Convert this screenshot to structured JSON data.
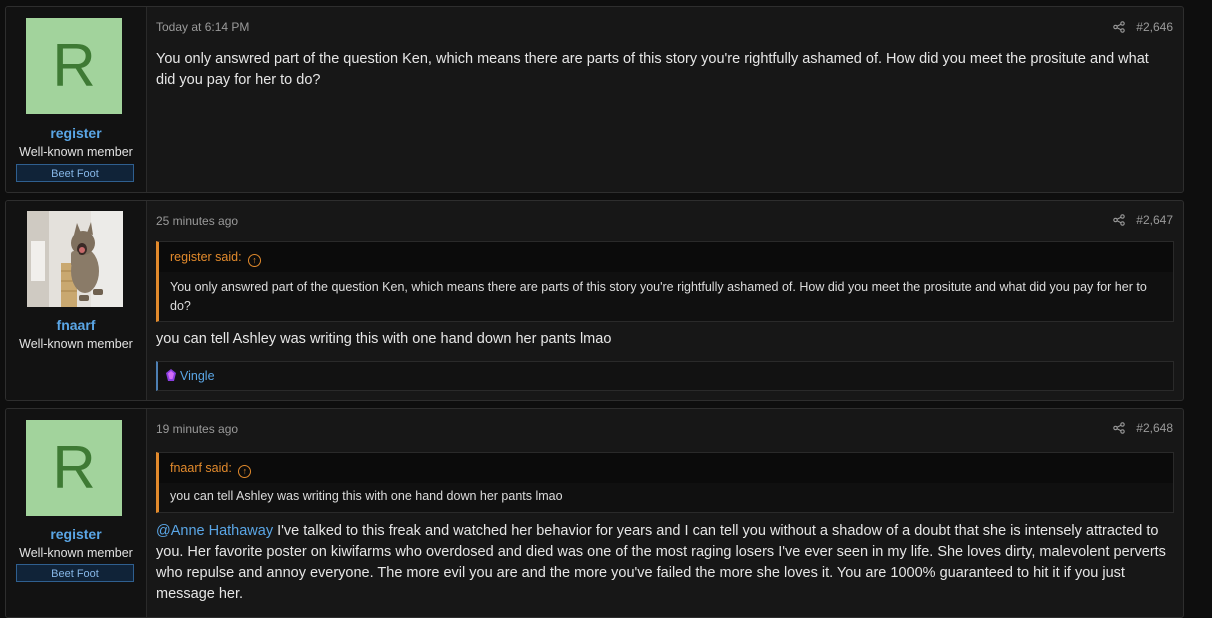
{
  "posts": [
    {
      "avatar_letter": "R",
      "username": "register",
      "user_title": "Well-known member",
      "user_badge": "Beet Foot",
      "time": "Today at 6:14 PM",
      "post_number": "#2,646",
      "body": "You only answred part of the question Ken, which means there are parts of this story you're rightfully ashamed of. How did you meet the prositute and what did you pay for her to do?"
    },
    {
      "avatar_image": "cat-photo",
      "username": "fnaarf",
      "user_title": "Well-known member",
      "time": "25 minutes ago",
      "post_number": "#2,647",
      "quote": {
        "author": "register said:",
        "text": "You only answred part of the question Ken, which means there are parts of this story you're rightfully ashamed of. How did you meet the prositute and what did you pay for her to do?"
      },
      "body": "you can tell Ashley was writing this with one hand down her pants lmao",
      "reactions": {
        "icon": "purple-reaction-icon",
        "users": "Vingle"
      }
    },
    {
      "avatar_letter": "R",
      "username": "register",
      "user_title": "Well-known member",
      "user_badge": "Beet Foot",
      "time": "19 minutes ago",
      "post_number": "#2,648",
      "quote": {
        "author": "fnaarf said:",
        "text": "you can tell Ashley was writing this with one hand down her pants lmao"
      },
      "mention": "@Anne Hathaway",
      "body": " I've talked to this freak and watched her behavior for years and I can tell you without a shadow of a doubt that she is intensely attracted to you. Her favorite poster on kiwifarms who overdosed and died was one of the most raging losers I've ever seen in my life. She loves dirty, malevolent perverts who repulse and annoy everyone. The more evil you are and the more you've failed the more she loves it. You are 1000% guaranteed to hit it if you just message her."
    }
  ],
  "icons": {
    "share": "share-icon",
    "quote_jump": "arrow-up-circle-icon"
  },
  "colors": {
    "link": "#5aa6e6",
    "quote_accent": "#e28a2c",
    "avatar_bg": "#a2d39c",
    "avatar_letter": "#3e7a34",
    "badge_bg": "#102338"
  }
}
